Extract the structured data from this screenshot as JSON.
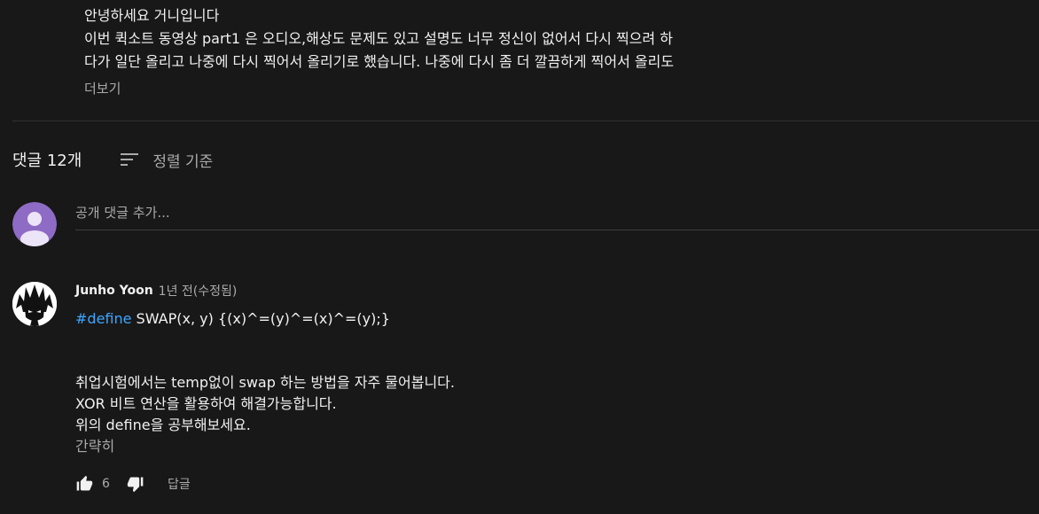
{
  "description": {
    "lines": [
      "안녕하세요 거니입니다",
      "이번 퀵소트 동영상 part1 은 오디오,해상도 문제도 있고 설명도 너무 정신이 없어서 다시 찍으려 하",
      "다가 일단 올리고 나중에 다시 찍어서 올리기로 했습니다. 나중에 다시 좀 더 깔끔하게 찍어서 올리도"
    ],
    "more_label": "더보기"
  },
  "comments_header": {
    "count_label": "댓글 12개",
    "sort_label": "정렬 기준"
  },
  "add_comment": {
    "placeholder": "공개 댓글 추가..."
  },
  "comment": {
    "author": "Junho Yoon",
    "timestamp": "1년 전(수정됨)",
    "hashtag": "#define",
    "code_rest": " SWAP(x, y) {(x)^=(y)^=(x)^=(y);}",
    "lines": [
      "취업시험에서는 temp없이 swap 하는 방법을 자주 물어봅니다.",
      "XOR 비트 연산을 활용하여 해결가능합니다.",
      "위의 define을 공부해보세요."
    ],
    "collapse_label": "간략히",
    "like_count": "6",
    "reply_label": "답글"
  },
  "colors": {
    "background": "#181818",
    "text_primary": "#f1f1f1",
    "text_secondary": "#aaaaaa",
    "link": "#3ea6ff",
    "avatar_self": "#8e6bc4"
  },
  "icons": {
    "sort": "sort-icon",
    "like": "thumb-up-icon",
    "dislike": "thumb-down-icon",
    "avatar_self": "user-avatar-icon",
    "avatar_author": "anime-character-avatar"
  }
}
